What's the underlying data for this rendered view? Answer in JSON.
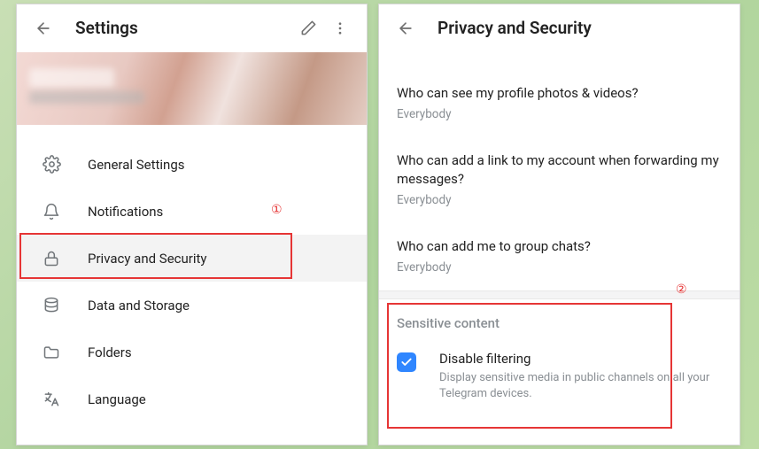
{
  "left": {
    "title": "Settings",
    "items": [
      {
        "name": "general-settings",
        "label": "General Settings"
      },
      {
        "name": "notifications",
        "label": "Notifications"
      },
      {
        "name": "privacy-security",
        "label": "Privacy and Security"
      },
      {
        "name": "data-storage",
        "label": "Data and Storage"
      },
      {
        "name": "folders",
        "label": "Folders"
      },
      {
        "name": "language",
        "label": "Language"
      }
    ]
  },
  "right": {
    "title": "Privacy and Security",
    "questions": [
      {
        "q": "Who can see my profile photos & videos?",
        "v": "Everybody"
      },
      {
        "q": "Who can add a link to my account when forwarding my messages?",
        "v": "Everybody"
      },
      {
        "q": "Who can add me to group chats?",
        "v": "Everybody"
      }
    ],
    "section_label": "Sensitive content",
    "checkbox": {
      "title": "Disable filtering",
      "desc": "Display sensitive media in public channels on all your Telegram devices.",
      "checked": true
    }
  },
  "annotations": {
    "one": "①",
    "two": "②"
  }
}
